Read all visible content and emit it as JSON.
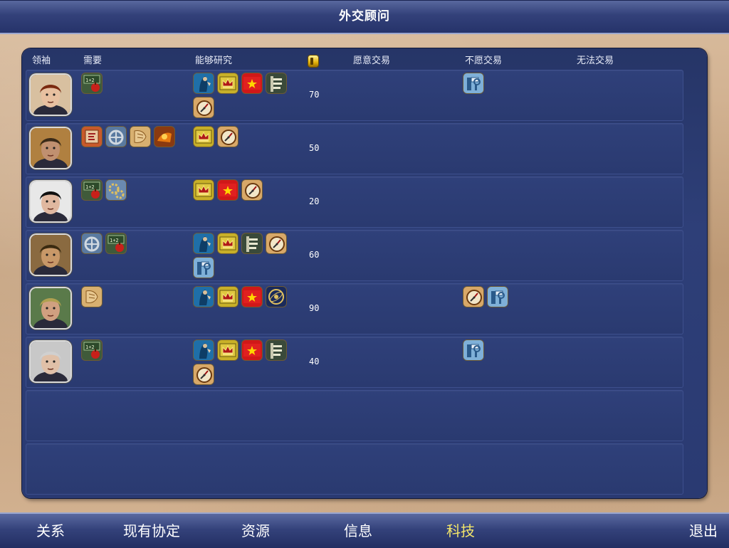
{
  "window": {
    "title": "外交顾问"
  },
  "columns": {
    "leader": "领袖",
    "needs": "需要",
    "can_research": "能够研究",
    "gold_icon": "gold-coin-icon",
    "willing": "愿意交易",
    "unwilling": "不愿交易",
    "cannot": "无法交易"
  },
  "rows": [
    {
      "portrait": "leader-woman-red-hair",
      "needs": [
        "school-tech-icon"
      ],
      "research": [
        "monotheism-icon",
        "monarchy-icon",
        "communism-icon",
        "construction-icon",
        "navigation-icon"
      ],
      "gold": "70",
      "willing": [],
      "unwilling": [
        "engineering-icon"
      ],
      "cannot": []
    },
    {
      "portrait": "leader-crowned-king",
      "needs": [
        "writing-tech-icon",
        "wheel-tech-icon",
        "scroll-tech-icon",
        "bronze-tech-icon"
      ],
      "research": [
        "monarchy-icon",
        "navigation-icon"
      ],
      "gold": "50",
      "willing": [],
      "unwilling": [],
      "cannot": []
    },
    {
      "portrait": "leader-tophat-man",
      "needs": [
        "school-tech-icon",
        "gears-tech-icon"
      ],
      "research": [
        "monarchy-icon",
        "communism-icon",
        "navigation-icon"
      ],
      "gold": "20",
      "willing": [],
      "unwilling": [],
      "cannot": []
    },
    {
      "portrait": "leader-mongol-warrior",
      "needs": [
        "wheel-tech-icon",
        "school-tech-icon"
      ],
      "research": [
        "monotheism-icon",
        "monarchy-icon",
        "construction-icon",
        "navigation-icon",
        "engineering-icon"
      ],
      "gold": "60",
      "willing": [],
      "unwilling": [],
      "cannot": []
    },
    {
      "portrait": "leader-helmet-soldier",
      "needs": [
        "scroll-tech-icon"
      ],
      "research": [
        "monotheism-icon",
        "monarchy-icon",
        "communism-icon",
        "astronomy-icon"
      ],
      "gold": "90",
      "willing": [],
      "unwilling": [
        "navigation-icon",
        "engineering-icon"
      ],
      "cannot": []
    },
    {
      "portrait": "leader-old-man-glasses",
      "needs": [
        "school-tech-icon"
      ],
      "research": [
        "monotheism-icon",
        "monarchy-icon",
        "communism-icon",
        "construction-icon",
        "navigation-icon"
      ],
      "gold": "40",
      "willing": [],
      "unwilling": [
        "engineering-icon"
      ],
      "cannot": []
    }
  ],
  "empty_rows": 2,
  "nav": {
    "relations": "关系",
    "agreements": "现有协定",
    "resources": "资源",
    "info": "信息",
    "tech": "科技",
    "exit": "退出"
  },
  "colors": {
    "active_nav": "#f3e66a",
    "panel": "#2e3f78"
  }
}
